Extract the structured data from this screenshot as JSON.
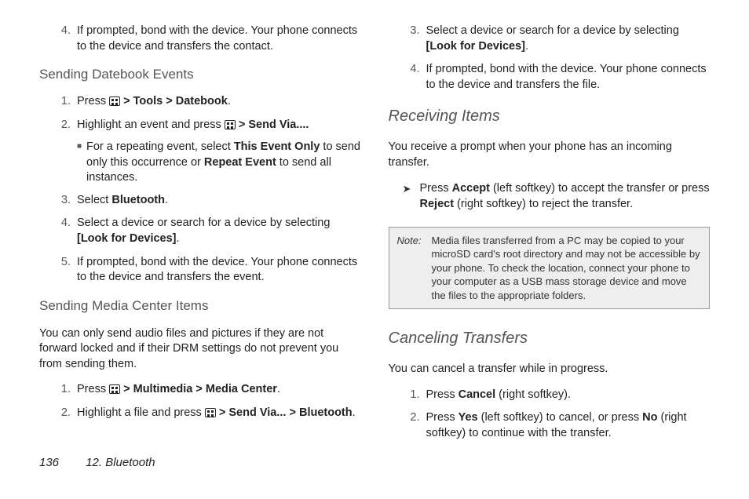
{
  "footer": {
    "page": "136",
    "chapter": "12. Bluetooth"
  },
  "left": {
    "step4_top": {
      "num": "4.",
      "text_a": "If prompted, bond with the device. Your phone connects to the device and transfers the contact."
    },
    "h_datebook": "Sending Datebook Events",
    "db_step1": {
      "num": "1.",
      "press": "Press ",
      "gt1": " > ",
      "tools": "Tools",
      "gt2": " > ",
      "datebook": "Datebook",
      "dot": "."
    },
    "db_step2": {
      "num": "2.",
      "text_a": "Highlight an event and press ",
      "gt": " > ",
      "sendvia": "Send Via....",
      "dot": ""
    },
    "db_step2_sub": {
      "text_a": "For a repeating event, select ",
      "this_event": "This Event Only",
      "text_b": " to send only this occurrence or ",
      "repeat": "Repeat Event",
      "text_c": " to send all instances."
    },
    "db_step3": {
      "num": "3.",
      "text_a": "Select ",
      "bt": "Bluetooth",
      "dot": "."
    },
    "db_step4": {
      "num": "4.",
      "text_a": "Select a device or search for a device by selecting ",
      "look": "[Look for Devices]",
      "dot": "."
    },
    "db_step5": {
      "num": "5.",
      "text_a": "If prompted, bond with the device. Your phone connects to the device and transfers the event."
    },
    "h_media": "Sending Media Center Items",
    "media_para": "You can only send audio files and pictures if they are not forward locked and if their DRM settings do not prevent you from sending them.",
    "mc_step1": {
      "num": "1.",
      "press": "Press ",
      "gt1": " > ",
      "mm": "Multimedia",
      "gt2": " > ",
      "mc": "Media Center",
      "dot": "."
    },
    "mc_step2": {
      "num": "2.",
      "text_a": "Highlight a file and press ",
      "gt1": " > ",
      "sendvia": "Send Via...",
      "gt2": " > ",
      "bt": "Bluetooth",
      "dot": "."
    }
  },
  "right": {
    "r_step3": {
      "num": "3.",
      "text_a": "Select a device or search for a device by selecting ",
      "look": "[Look for Devices]",
      "dot": "."
    },
    "r_step4": {
      "num": "4.",
      "text_a": "If prompted, bond with the device. Your phone connects to the device and transfers the file."
    },
    "h_recv": "Receiving Items",
    "recv_para": "You receive a prompt when your phone has an incoming transfer.",
    "recv_item": {
      "text_a": "Press ",
      "accept": "Accept",
      "text_b": " (left softkey) to accept the transfer or press ",
      "reject": "Reject",
      "text_c": " (right softkey) to reject the transfer."
    },
    "note": {
      "label": "Note:",
      "body": "Media files transferred from a PC may be copied to your microSD card's root directory and may not be accessible by your phone. To check the location, connect your phone to your computer as a USB mass storage device and move the files to the appropriate folders."
    },
    "h_cancel": "Canceling Transfers",
    "cancel_para": "You can cancel a transfer while in progress.",
    "c_step1": {
      "num": "1.",
      "text_a": "Press ",
      "cancel": "Cancel",
      "text_b": " (right softkey)."
    },
    "c_step2": {
      "num": "2.",
      "text_a": "Press ",
      "yes": "Yes",
      "text_b": " (left softkey) to cancel, or press ",
      "no": "No",
      "text_c": " (right softkey) to continue with the transfer."
    }
  }
}
